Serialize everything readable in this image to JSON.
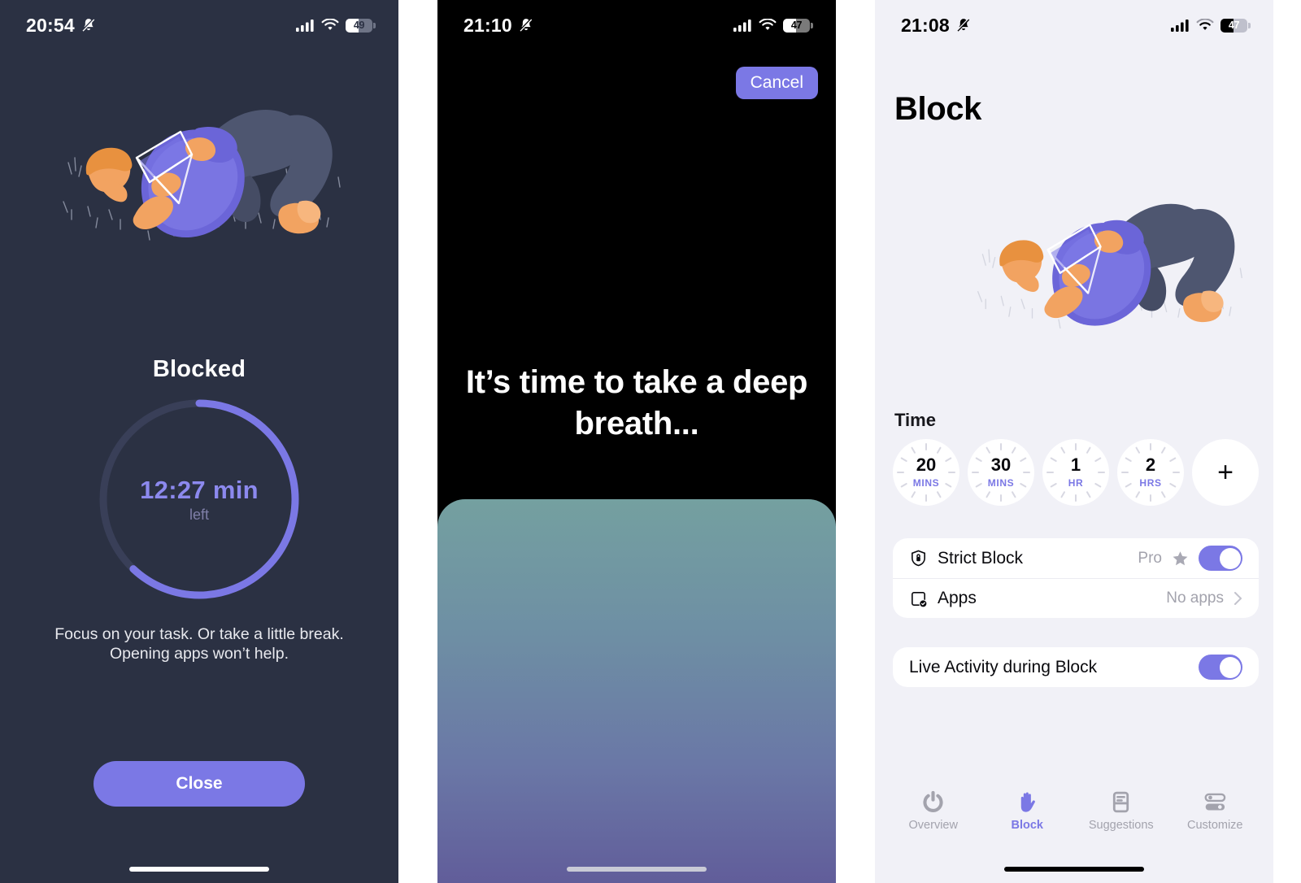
{
  "colors": {
    "accent": "#7B78E5",
    "accent_text": "#8C89EE",
    "dark_bg": "#2B3143",
    "black_bg": "#000000",
    "light_bg": "#F1F1F7",
    "card_bg": "#FFFFFF",
    "muted_text": "#A3A3AD",
    "gradient_top": "#74A0A0",
    "gradient_bottom": "#615D9A"
  },
  "panel_blocked": {
    "status": {
      "time": "20:54",
      "bell_icon": "bell-slash-icon",
      "signal_icon": "cellular-signal-icon",
      "wifi_icon": "wifi-icon",
      "battery_level": "49",
      "battery_percent": 49
    },
    "illustration": "person-reading-in-grass-illustration",
    "title": "Blocked",
    "timer": {
      "value": "12:27 min",
      "caption": "left",
      "progress_percent": 62
    },
    "description": "Focus on your task. Or take a little break. Opening apps won’t help.",
    "close_label": "Close"
  },
  "panel_breathe": {
    "status": {
      "time": "21:10",
      "bell_icon": "bell-slash-icon",
      "signal_icon": "cellular-signal-icon",
      "wifi_icon": "wifi-icon",
      "battery_level": "47",
      "battery_percent": 47
    },
    "cancel_label": "Cancel",
    "message": "It’s time to take a deep breath..."
  },
  "panel_block_settings": {
    "status": {
      "time": "21:08",
      "bell_icon": "bell-slash-icon",
      "signal_icon": "cellular-signal-icon",
      "wifi_icon": "wifi-icon",
      "battery_level": "47",
      "battery_percent": 47
    },
    "page_title": "Block",
    "illustration": "person-reading-in-grass-illustration",
    "time_section_label": "Time",
    "time_options": [
      {
        "value": "20",
        "unit": "MINS"
      },
      {
        "value": "30",
        "unit": "MINS"
      },
      {
        "value": "1",
        "unit": "HR"
      },
      {
        "value": "2",
        "unit": "HRS"
      }
    ],
    "time_add_label": "+",
    "settings_group_1": [
      {
        "icon": "shield-lock-icon",
        "label": "Strict Block",
        "badge": "Pro",
        "badge_icon": "star-icon",
        "control": "toggle",
        "toggle_on": true
      },
      {
        "icon": "app-check-icon",
        "label": "Apps",
        "value": "No apps",
        "control": "chevron",
        "chevron_icon": "chevron-right-icon"
      }
    ],
    "settings_group_2": [
      {
        "label": "Live Activity during Block",
        "control": "toggle",
        "toggle_on": true
      }
    ],
    "tabs": [
      {
        "label": "Overview",
        "icon": "gauge-power-icon",
        "active": false
      },
      {
        "label": "Block",
        "icon": "hand-stop-icon",
        "active": true
      },
      {
        "label": "Suggestions",
        "icon": "card-list-icon",
        "active": false
      },
      {
        "label": "Customize",
        "icon": "sliders-icon",
        "active": false
      }
    ]
  }
}
